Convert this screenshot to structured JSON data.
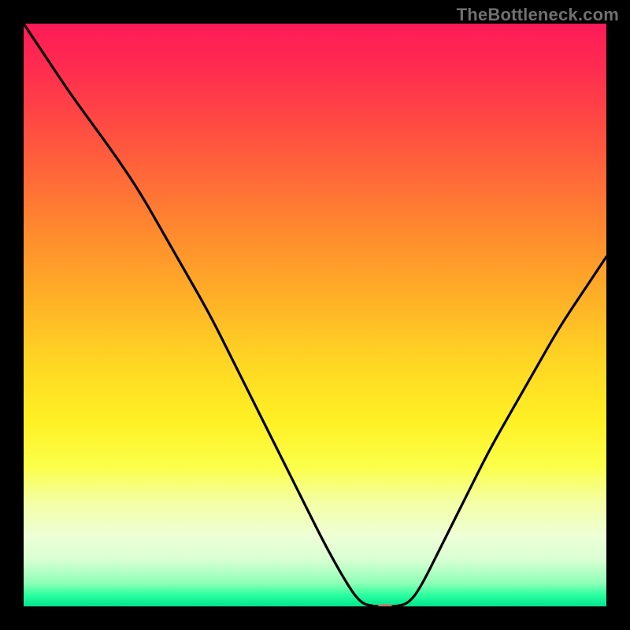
{
  "watermark": "TheBottleneck.com",
  "marker": {
    "x_pct": 62,
    "y_pct": 100.5
  },
  "chart_data": {
    "type": "line",
    "title": "",
    "xlabel": "",
    "ylabel": "",
    "xlim": [
      0,
      100
    ],
    "ylim": [
      0,
      100
    ],
    "grid": false,
    "legend": false,
    "note": "Curve read visually; y is height from bottom (0=bottom, 100=top). Dip reaches 0 near x≈58–66; marker at x≈62.",
    "series": [
      {
        "name": "bottleneck-curve",
        "x": [
          0,
          4,
          8,
          12,
          16,
          20,
          24,
          28,
          32,
          36,
          40,
          44,
          48,
          52,
          56,
          58,
          60,
          62,
          64,
          66,
          68,
          72,
          76,
          80,
          84,
          88,
          92,
          96,
          100
        ],
        "y": [
          100,
          94,
          88,
          82.5,
          77,
          71,
          64,
          57,
          50,
          42,
          34,
          26,
          18,
          10,
          3,
          0.5,
          0,
          0,
          0,
          0.5,
          3,
          11,
          19,
          27,
          34,
          41,
          48,
          54,
          60
        ]
      }
    ],
    "background_gradient": {
      "orientation": "vertical",
      "stops": [
        {
          "pos": 0.0,
          "color": "#ff1a58"
        },
        {
          "pos": 0.22,
          "color": "#ff5a3d"
        },
        {
          "pos": 0.48,
          "color": "#ffb326"
        },
        {
          "pos": 0.68,
          "color": "#fff024"
        },
        {
          "pos": 0.88,
          "color": "#eeffd6"
        },
        {
          "pos": 1.0,
          "color": "#00e58e"
        }
      ]
    }
  }
}
